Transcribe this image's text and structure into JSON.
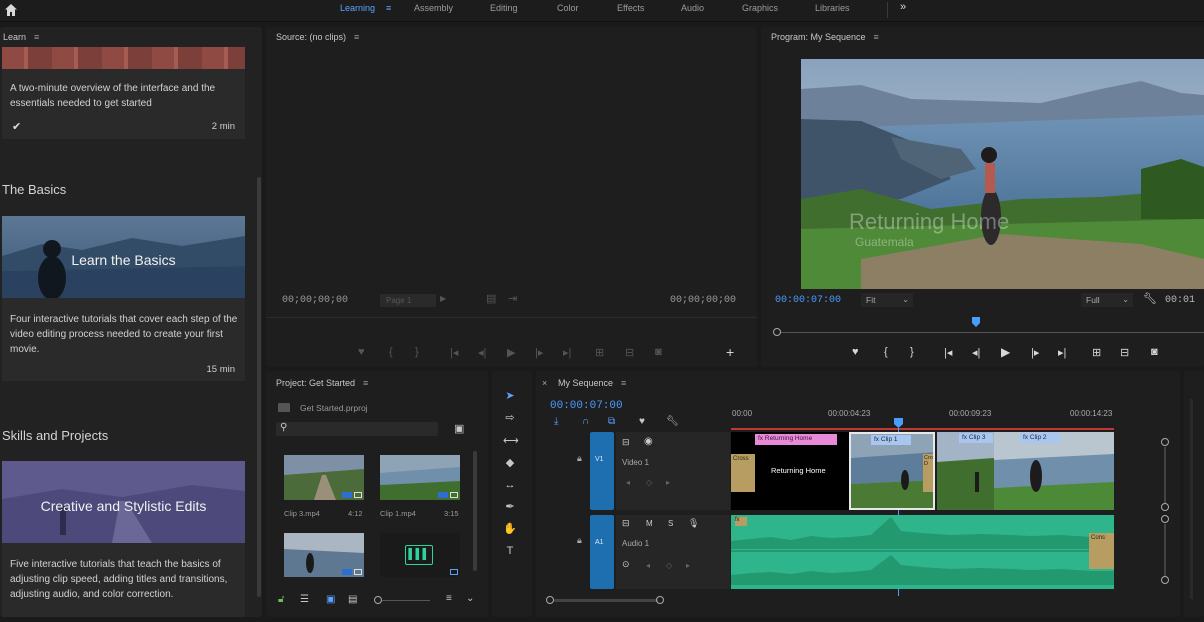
{
  "workspaces": [
    "Learning",
    "Assembly",
    "Editing",
    "Color",
    "Effects",
    "Audio",
    "Graphics",
    "Libraries"
  ],
  "workspaces_more": "»",
  "learn": {
    "title": "Learn",
    "intro_desc": "A two-minute overview of the interface and the essentials needed to get started",
    "intro_duration": "2 min",
    "basics_heading": "The Basics",
    "basics_thumb_title": "Learn the Basics",
    "basics_desc": "Four interactive tutorials that cover each step of the video editing process needed to create your first movie.",
    "basics_duration": "15 min",
    "skills_heading": "Skills and Projects",
    "skills_thumb_title": "Creative and Stylistic Edits",
    "skills_desc": "Five interactive tutorials that teach the basics of adjusting clip speed, adding titles and transitions, adjusting audio, and color correction."
  },
  "source": {
    "title": "Source: (no clips)",
    "tc_left": "00;00;00;00",
    "page": "Page 1",
    "tc_right": "00;00;00;00"
  },
  "program": {
    "title": "Program: My Sequence",
    "tc": "00:00:07:00",
    "fit": "Fit",
    "full": "Full",
    "tc_right": "00:01",
    "overlay_title": "Returning Home",
    "overlay_sub": "Guatemala"
  },
  "project": {
    "title": "Project: Get Started",
    "file": "Get Started.prproj",
    "items": [
      {
        "name": "Clip 3.mp4",
        "dur": "4:12"
      },
      {
        "name": "Clip 1.mp4",
        "dur": "3:15"
      }
    ]
  },
  "timeline": {
    "title": "My Sequence",
    "tc": "00:00:07:00",
    "ruler": [
      "00:00",
      "00:00:04:23",
      "00:00:09:23",
      "00:00:14:23"
    ],
    "v1": "V1",
    "v1_name": "Video 1",
    "a1": "A1",
    "a1_name": "Audio 1",
    "clips": {
      "title_clip": "Returning Home",
      "title_fx": "Returning Home",
      "clip1": "Clip 1",
      "clip3": "Clip 3",
      "clip2": "Clip 2",
      "cross_left": "Cross",
      "cross_mid": "Cross D",
      "cross_audio": "Cons"
    }
  },
  "colors": {
    "accent": "#4a9cff",
    "track_blue": "#1d6fb0",
    "audio_green": "#2fb58c",
    "title_pink": "#e98ad9"
  }
}
